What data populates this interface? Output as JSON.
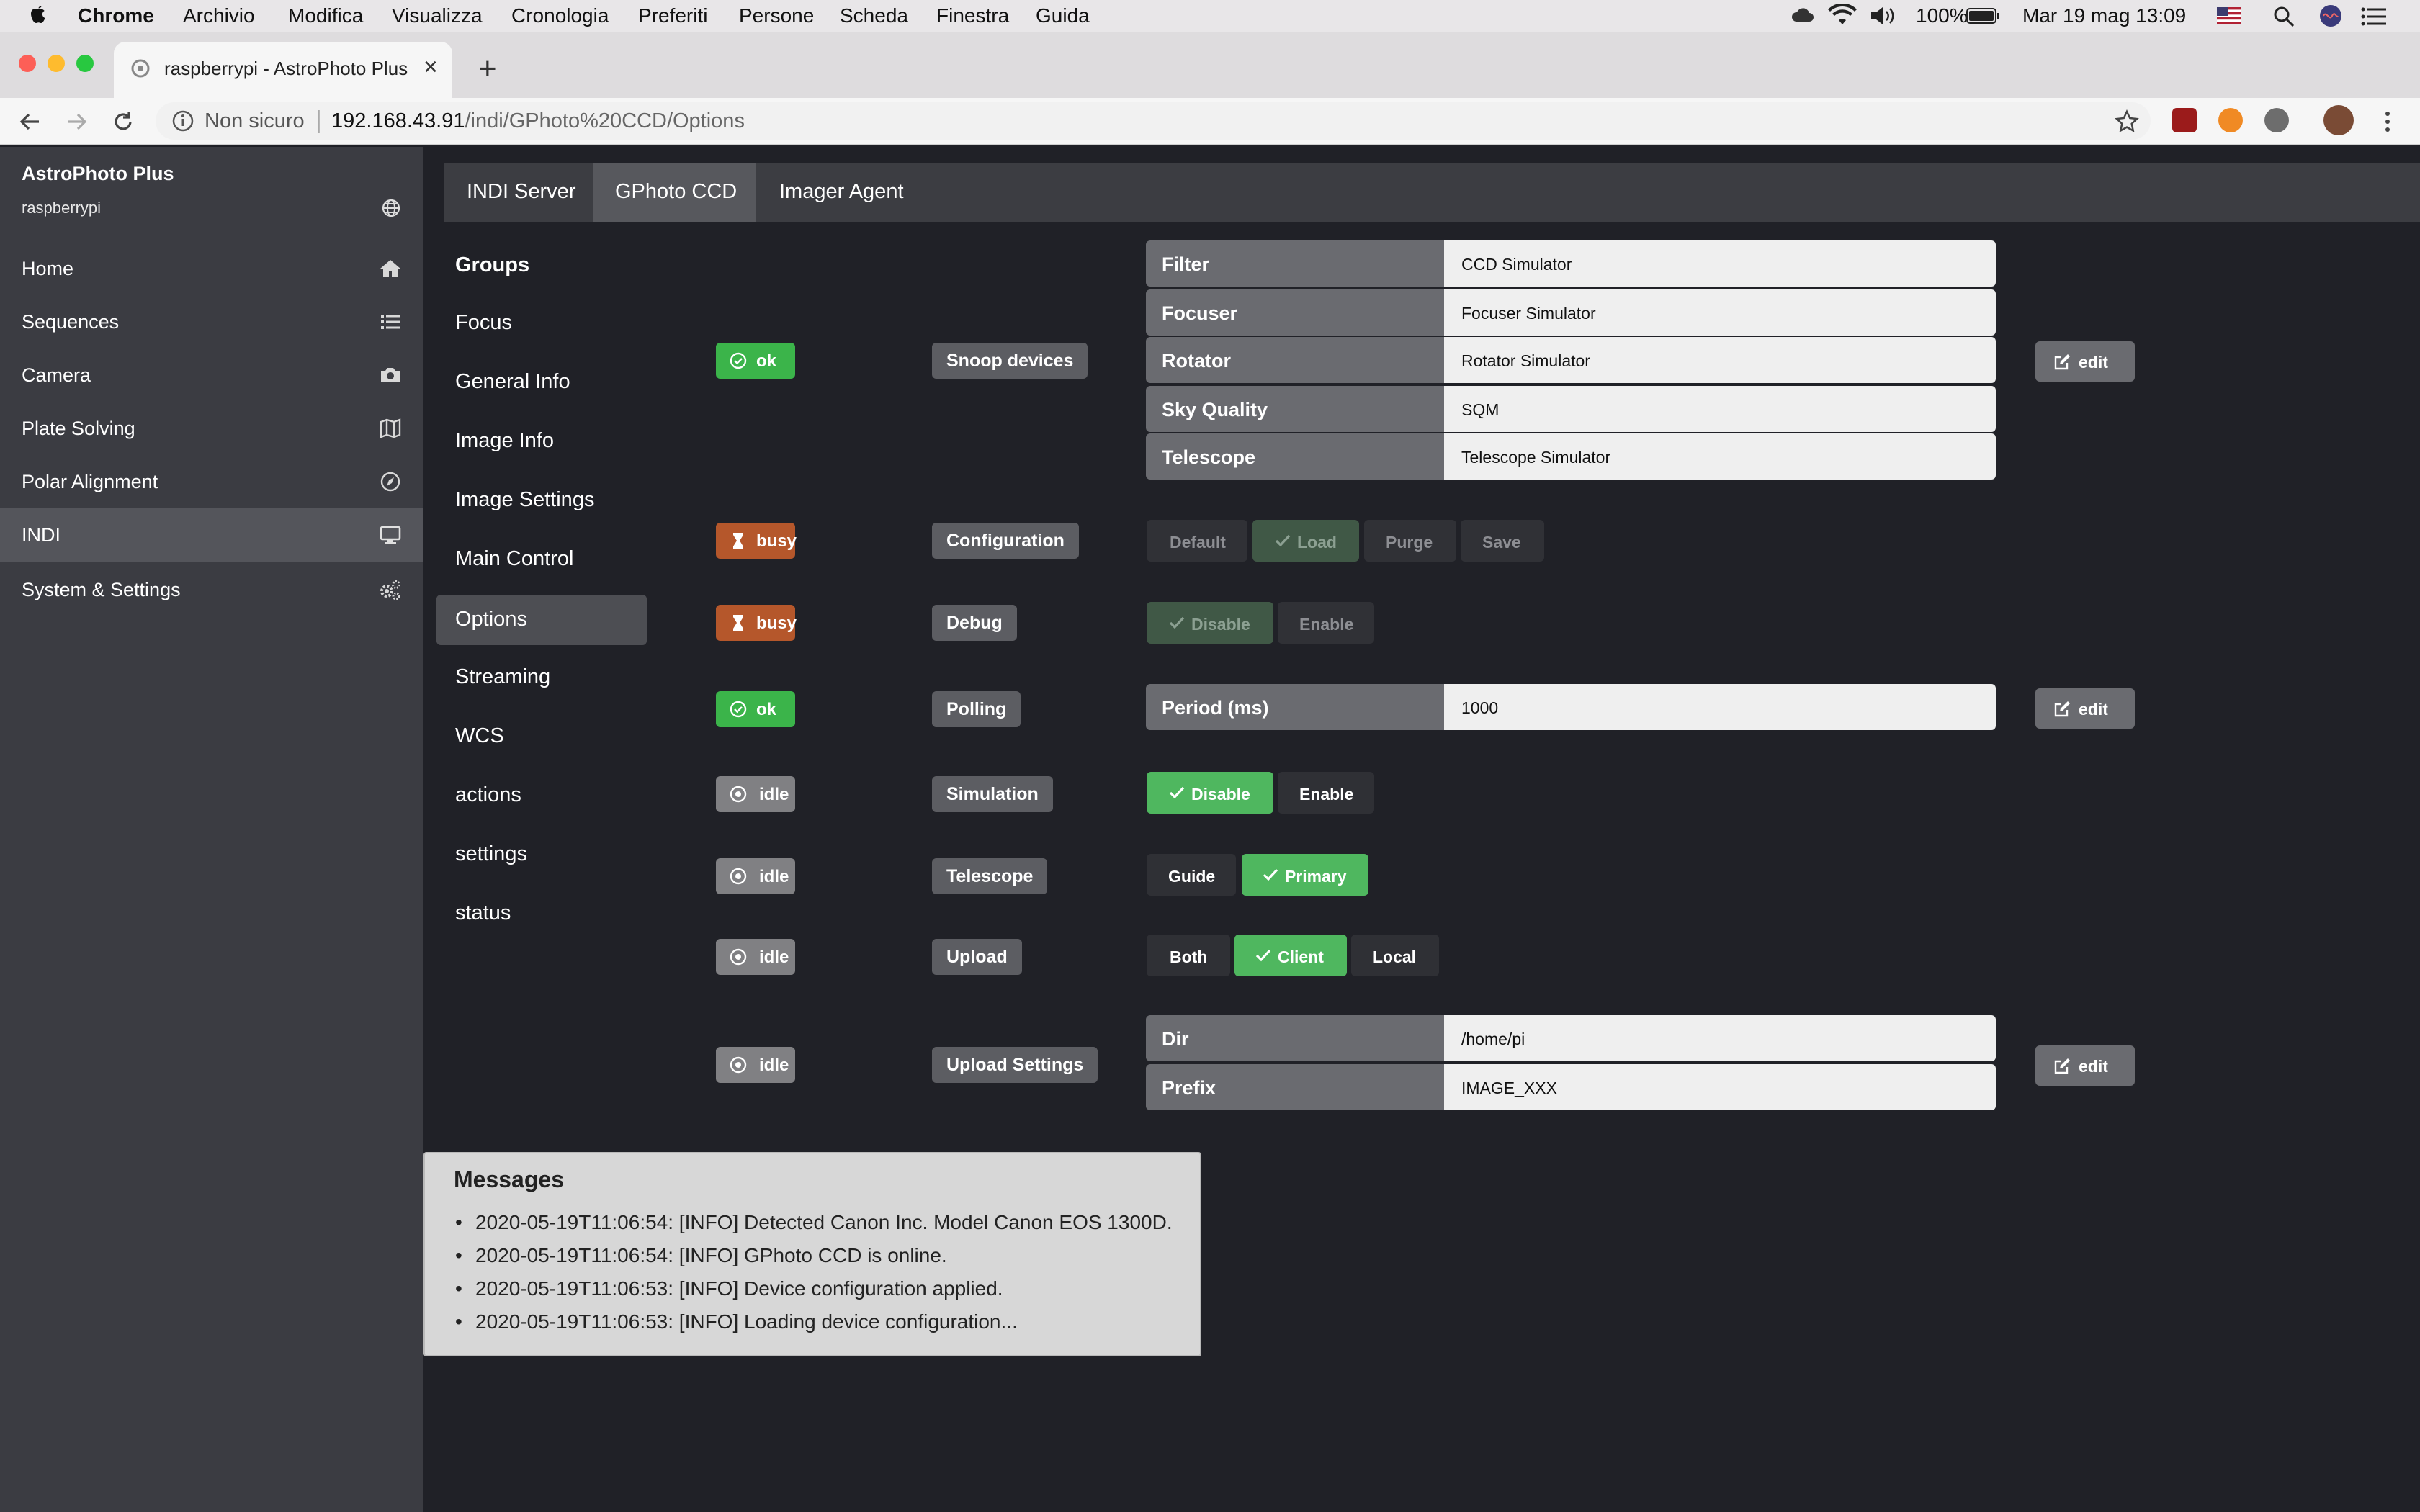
{
  "menubar": {
    "app": "Chrome",
    "menus": [
      "Archivio",
      "Modifica",
      "Visualizza",
      "Cronologia",
      "Preferiti",
      "Persone",
      "Scheda",
      "Finestra",
      "Guida"
    ],
    "battery": "100%",
    "clock": "Mar 19 mag  13:09"
  },
  "browser": {
    "tab_title": "raspberrypi - AstroPhoto Plus",
    "insecure_label": "Non sicuro",
    "url_host": "192.168.43.91",
    "url_path": "/indi/GPhoto%20CCD/Options"
  },
  "sidebar": {
    "title": "AstroPhoto Plus",
    "host": "raspberrypi",
    "items": [
      {
        "label": "Home",
        "icon": "home-icon"
      },
      {
        "label": "Sequences",
        "icon": "list-icon"
      },
      {
        "label": "Camera",
        "icon": "camera-icon"
      },
      {
        "label": "Plate Solving",
        "icon": "map-icon"
      },
      {
        "label": "Polar Alignment",
        "icon": "compass-icon"
      },
      {
        "label": "INDI",
        "icon": "monitor-icon",
        "active": true
      },
      {
        "label": "System & Settings",
        "icon": "cogs-icon"
      }
    ]
  },
  "device_tabs": [
    "INDI Server",
    "GPhoto CCD",
    "Imager Agent"
  ],
  "active_device_tab": "GPhoto CCD",
  "groups": {
    "title": "Groups",
    "items": [
      "Focus",
      "General Info",
      "Image Info",
      "Image Settings",
      "Main Control",
      "Options",
      "Streaming",
      "WCS",
      "actions",
      "settings",
      "status"
    ],
    "active": "Options"
  },
  "properties": {
    "snoop": {
      "status": "ok",
      "name": "Snoop devices",
      "fields": [
        {
          "key": "Filter",
          "value": "CCD Simulator"
        },
        {
          "key": "Focuser",
          "value": "Focuser Simulator"
        },
        {
          "key": "Rotator",
          "value": "Rotator Simulator"
        },
        {
          "key": "Sky Quality",
          "value": "SQM"
        },
        {
          "key": "Telescope",
          "value": "Telescope Simulator"
        }
      ],
      "edit": "edit"
    },
    "configuration": {
      "status": "busy",
      "name": "Configuration",
      "switches": [
        "Default",
        "Load",
        "Purge",
        "Save"
      ],
      "selected": "Load"
    },
    "debug": {
      "status": "busy",
      "name": "Debug",
      "switches": [
        "Disable",
        "Enable"
      ],
      "selected": "Disable"
    },
    "polling": {
      "status": "ok",
      "name": "Polling",
      "fields": [
        {
          "key": "Period (ms)",
          "value": "1000"
        }
      ],
      "edit": "edit"
    },
    "simulation": {
      "status": "idle",
      "name": "Simulation",
      "switches": [
        "Disable",
        "Enable"
      ],
      "selected": "Disable"
    },
    "telescope": {
      "status": "idle",
      "name": "Telescope",
      "switches": [
        "Guide",
        "Primary"
      ],
      "selected": "Primary"
    },
    "upload": {
      "status": "idle",
      "name": "Upload",
      "switches": [
        "Both",
        "Client",
        "Local"
      ],
      "selected": "Client"
    },
    "upload_settings": {
      "status": "idle",
      "name": "Upload Settings",
      "fields": [
        {
          "key": "Dir",
          "value": "/home/pi"
        },
        {
          "key": "Prefix",
          "value": "IMAGE_XXX"
        }
      ],
      "edit": "edit"
    }
  },
  "messages": {
    "title": "Messages",
    "items": [
      "2020-05-19T11:06:54: [INFO] Detected Canon Inc. Model Canon EOS 1300D.",
      "2020-05-19T11:06:54: [INFO] GPhoto CCD is online.",
      "2020-05-19T11:06:53: [INFO] Device configuration applied.",
      "2020-05-19T11:06:53: [INFO] Loading device configuration..."
    ]
  },
  "colors": {
    "ok": "#3bb44a",
    "busy": "#b5572b",
    "idle": "#808083",
    "switch_on": "#4fb75f"
  }
}
